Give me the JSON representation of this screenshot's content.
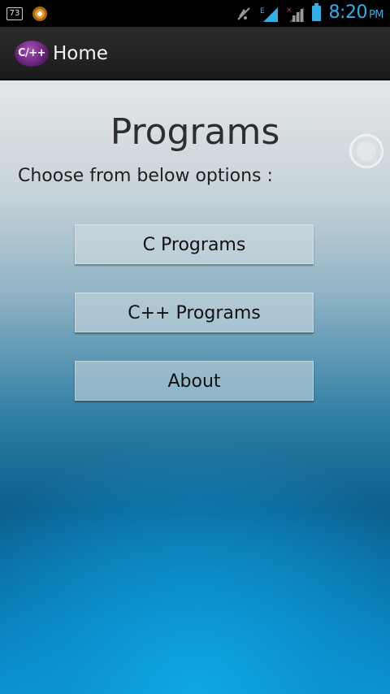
{
  "status_bar": {
    "notification_count": "73",
    "time": "8:20",
    "ampm": "PM",
    "network_type": "E",
    "icons": [
      "notification-count-icon",
      "app-notification-icon",
      "mute-icon",
      "signal-e-icon",
      "signal-no-service-icon",
      "battery-icon"
    ]
  },
  "action_bar": {
    "logo_text": "C/++",
    "title": "Home"
  },
  "main": {
    "title": "Programs",
    "subtitle": "Choose from below options :",
    "buttons": [
      {
        "label": "C Programs"
      },
      {
        "label": "C++ Programs"
      },
      {
        "label": "About"
      }
    ]
  },
  "colors": {
    "accent": "#35aee8",
    "logo": "#7a2d8c"
  }
}
